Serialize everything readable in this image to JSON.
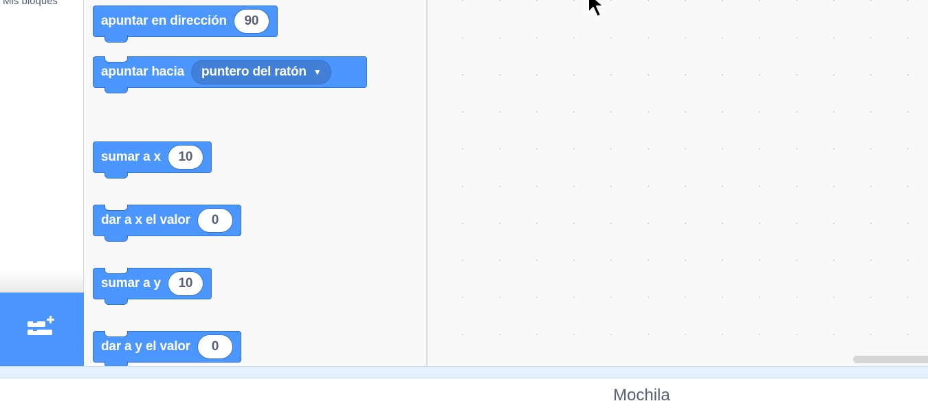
{
  "categories": {
    "my_blocks_label": "Mis bloques",
    "extension_button": {
      "icon": "add-extension-icon",
      "color": "#4c97ff"
    }
  },
  "palette": {
    "block_color": "#4c97ff",
    "blocks": [
      {
        "text": "apuntar en dirección",
        "input": "90"
      },
      {
        "text": "apuntar hacia",
        "dropdown": "puntero del ratón"
      },
      {
        "text": "sumar a x",
        "input": "10"
      },
      {
        "text": "dar a x el valor",
        "input": "0"
      },
      {
        "text": "sumar a y",
        "input": "10"
      },
      {
        "text": "dar a y el valor",
        "input": "0"
      }
    ]
  },
  "workspace": {
    "cursor_icon": "mouse-pointer-icon"
  },
  "backpack": {
    "title": "Mochila"
  }
}
